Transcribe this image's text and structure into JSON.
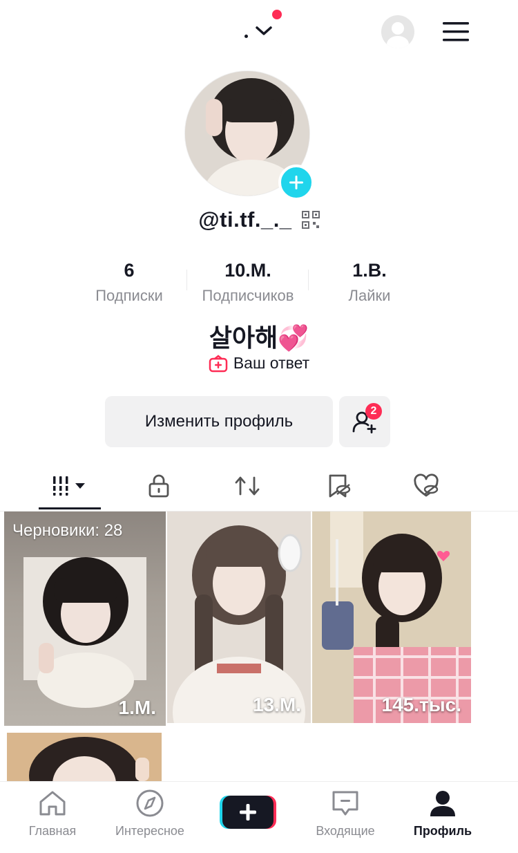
{
  "topbar": {
    "switcher_icon": "chevron-down-icon",
    "menu_icon": "hamburger-menu-icon",
    "profile_icon": "avatar-placeholder-icon"
  },
  "profile": {
    "username": "@ti.tf._._",
    "qr_icon": "qr-code-icon",
    "add_icon": "plus-icon",
    "bio": "살아해💞",
    "reply_label": "Ваш ответ"
  },
  "stats": [
    {
      "value": "6",
      "label": "Подписки"
    },
    {
      "value": "10.M.",
      "label": "Подписчиков"
    },
    {
      "value": "1.B.",
      "label": "Лайки"
    }
  ],
  "actions": {
    "edit_label": "Изменить профиль",
    "friends_badge": "2"
  },
  "tabs": [
    {
      "icon": "grid-videos-icon"
    },
    {
      "icon": "lock-icon"
    },
    {
      "icon": "repost-icon"
    },
    {
      "icon": "favorites-hidden-icon"
    },
    {
      "icon": "liked-hidden-icon"
    }
  ],
  "videos": [
    {
      "label": "Черновики: 28",
      "views": "1.M."
    },
    {
      "views": "13.M."
    },
    {
      "views": "145.тыс."
    }
  ],
  "bottom_nav": [
    {
      "label": "Главная",
      "icon": "home-icon"
    },
    {
      "label": "Интересное",
      "icon": "compass-icon"
    },
    {
      "label": "",
      "icon": "plus-icon"
    },
    {
      "label": "Входящие",
      "icon": "inbox-icon"
    },
    {
      "label": "Профиль",
      "icon": "profile-icon"
    }
  ],
  "colors": {
    "accent_pink": "#fe2c55",
    "accent_cyan": "#20d5ec",
    "text": "#161823",
    "muted": "#8a8b91"
  }
}
